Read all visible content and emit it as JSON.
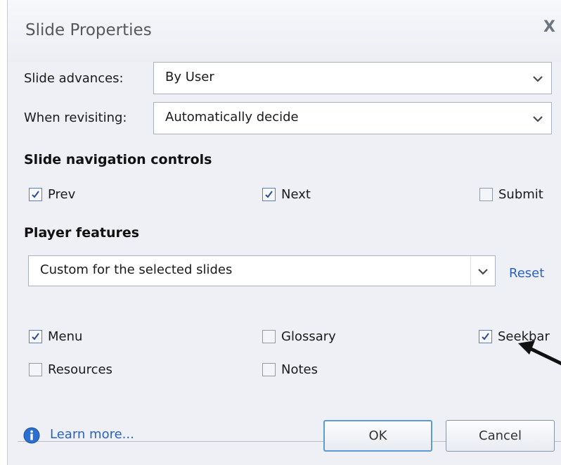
{
  "dialog": {
    "title": "Slide Properties",
    "close_glyph": "X"
  },
  "fields": {
    "slide_advances": {
      "label": "Slide advances:",
      "value": "By User"
    },
    "when_revisiting": {
      "label": "When revisiting:",
      "value": "Automatically decide"
    }
  },
  "nav_controls": {
    "heading": "Slide navigation controls",
    "items": [
      {
        "label": "Prev",
        "checked": true
      },
      {
        "label": "Next",
        "checked": true
      },
      {
        "label": "Submit",
        "checked": false
      }
    ]
  },
  "player_features": {
    "heading": "Player features",
    "select_value": "Custom for the selected slides",
    "reset_label": "Reset",
    "items": [
      {
        "label": "Menu",
        "checked": true
      },
      {
        "label": "Glossary",
        "checked": false
      },
      {
        "label": "Seekbar",
        "checked": true
      },
      {
        "label": "Resources",
        "checked": false
      },
      {
        "label": "Notes",
        "checked": false
      }
    ]
  },
  "footer": {
    "learn_more": "Learn more...",
    "ok_label": "OK",
    "cancel_label": "Cancel",
    "info_icon": "info-icon"
  },
  "colors": {
    "accent": "#2a63c1",
    "dialog_bg": "#eef0f6",
    "focus_border": "#5b9bd6"
  }
}
